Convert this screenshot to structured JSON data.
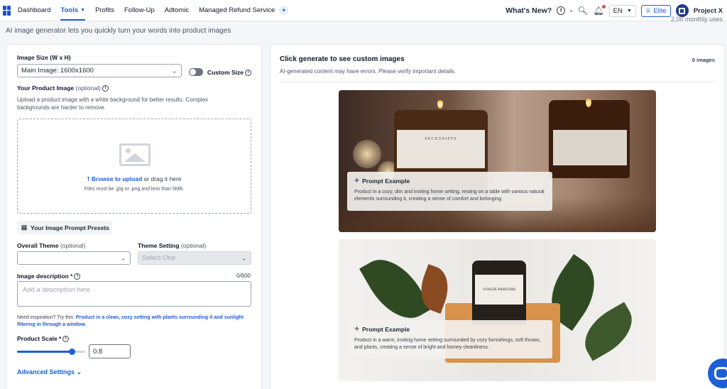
{
  "nav": {
    "items": [
      {
        "label": "Dashboard",
        "active": false,
        "dropdown": false
      },
      {
        "label": "Tools",
        "active": true,
        "dropdown": true
      },
      {
        "label": "Profits",
        "active": false,
        "dropdown": false
      },
      {
        "label": "Follow-Up",
        "active": false,
        "dropdown": false
      },
      {
        "label": "Adtomic",
        "active": false,
        "dropdown": false
      },
      {
        "label": "Managed Refund Service",
        "active": false,
        "dropdown": false
      }
    ],
    "whats_new": "What's New?",
    "language": "EN",
    "plan": "Elite",
    "account": "Project X",
    "icons": [
      "logo-grid-icon",
      "sparkle-icon",
      "facebook-icon",
      "rocket-icon",
      "bell-icon",
      "crown-icon",
      "chevron-down-icon"
    ]
  },
  "page": {
    "subtitle": "AI image generator lets you quickly turn your words into product images",
    "monthly_uses": "2,00 monthly uses"
  },
  "form": {
    "image_size": {
      "label": "Image Size (W x H)",
      "value": "Main Image: 1600x1600"
    },
    "custom_size": {
      "label": "Custom Size",
      "enabled": false
    },
    "product_image": {
      "label": "Your Product Image",
      "optional": "(optional)",
      "help": "Upload a product image with a white background for better results. Complex backgrounds are harder to remove.",
      "browse": "Browse to upload",
      "drag": " or drag it here",
      "files": "Files must be .jpg or .png and less than 5MB."
    },
    "presets_button": "Your Image Prompt Presets",
    "overall_theme": {
      "label": "Overall Theme",
      "optional": "(optional)",
      "value": ""
    },
    "theme_setting": {
      "label": "Theme Setting",
      "optional": "(optional)",
      "placeholder": "Select One"
    },
    "description": {
      "label": "Image description *",
      "placeholder": "Add a description here",
      "counter": "0/600"
    },
    "inspiration": {
      "prefix": "Need inspiration? Try this:",
      "example": "Product in a clean, cozy setting with plants surrounding it and sunlight filtering in through a window."
    },
    "product_scale": {
      "label": "Product Scale *",
      "value": "0.8",
      "fraction": 0.8
    },
    "advanced": "Advanced Settings"
  },
  "results": {
    "title": "Click generate to see custom images",
    "count": "0 images",
    "note": "AI-generated content may have errors. Please verify important details.",
    "examples": [
      {
        "heading": "Prompt Example",
        "text": "Product in a cozy, dim and inviting home setting, resting on a table with various natural elements surrounding it, creating a sense of comfort and belonging."
      },
      {
        "heading": "Prompt Example",
        "text": "Product in a warm, inviting home setting surrounded by cozy furnishings, soft throws, and plants, creating a sense of bright and homey cleanliness."
      }
    ],
    "candle_labels": [
      "PECKSNIFFS",
      "VOSGIE PARFUMS"
    ]
  },
  "colors": {
    "accent": "#1d5fd6",
    "text": "#111827"
  }
}
